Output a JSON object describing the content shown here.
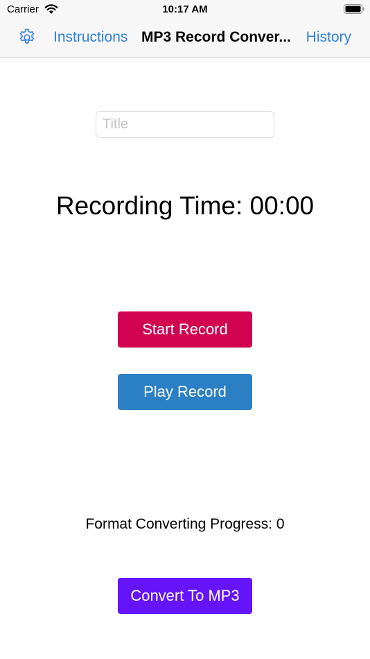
{
  "status_bar": {
    "carrier": "Carrier",
    "time": "10:17 AM",
    "wifi_icon": "wifi-icon",
    "battery_icon": "battery-icon"
  },
  "nav": {
    "settings_icon": "gear-icon",
    "left_link": "Instructions",
    "title": "MP3 Record Conver...",
    "right_link": "History",
    "accent_color": "#2f7fe0"
  },
  "form": {
    "title_placeholder": "Title",
    "title_value": ""
  },
  "recording": {
    "label": "Recording Time: 00:00"
  },
  "buttons": {
    "start": "Start Record",
    "play": "Play Record",
    "convert": "Convert To MP3",
    "start_color": "#d1024f",
    "play_color": "#2b80c5",
    "convert_color": "#6514fb"
  },
  "progress": {
    "label": "Format Converting Progress: 0"
  }
}
